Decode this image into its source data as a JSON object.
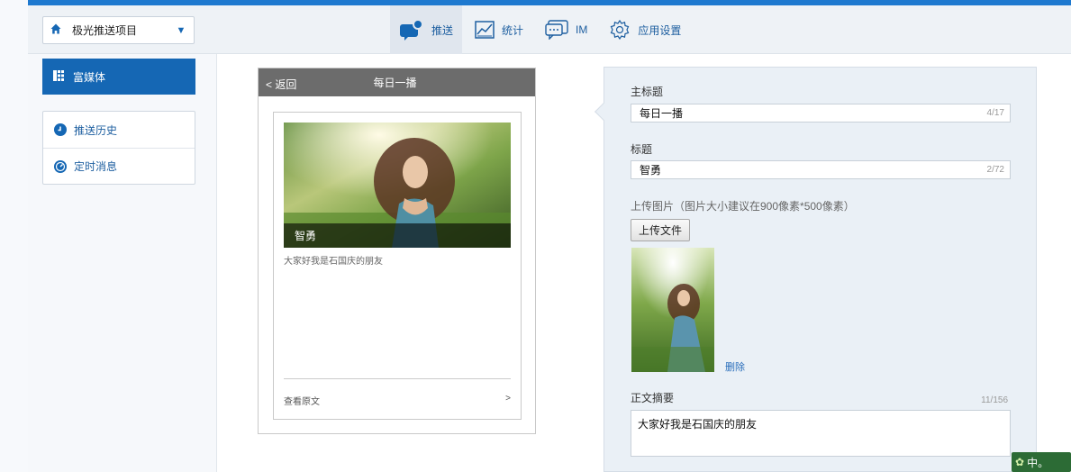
{
  "topnav": {
    "project_name": "极光推送项目",
    "tabs": [
      {
        "label": "推送",
        "icon": "chat-bubble-icon",
        "active": true
      },
      {
        "label": "统计",
        "icon": "chart-icon",
        "active": false
      },
      {
        "label": "IM",
        "icon": "im-message-icon",
        "active": false
      },
      {
        "label": "应用设置",
        "icon": "gear-icon",
        "active": false
      }
    ]
  },
  "sidebar": {
    "active_item": {
      "label": "富媒体",
      "icon": "grid-icon"
    },
    "items": [
      {
        "label": "推送历史",
        "icon": "clock-icon"
      },
      {
        "label": "定时消息",
        "icon": "timer-icon"
      }
    ]
  },
  "preview": {
    "back_label": "< 返回",
    "title": "每日一播",
    "caption": "智勇",
    "description": "大家好我是石国庆的朋友",
    "read_more": "查看原文",
    "read_more_arrow": ">"
  },
  "form": {
    "main_title_label": "主标题",
    "main_title_value": "每日一播",
    "main_title_count": "4/17",
    "title_label": "标题",
    "title_value": "智勇",
    "title_count": "2/72",
    "upload_label": "上传图片（图片大小建议在900像素*500像素）",
    "upload_button": "上传文件",
    "delete_label": "删除",
    "summary_label": "正文摘要",
    "summary_count": "11/156",
    "summary_value": "大家好我是石国庆的朋友"
  },
  "ime": {
    "text": "中。"
  },
  "colors": {
    "accent": "#1567b4",
    "topline": "#1e79cf",
    "panel_bg": "#eaf0f6"
  }
}
